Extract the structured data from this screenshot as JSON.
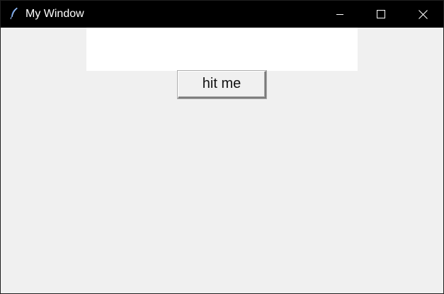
{
  "window": {
    "title": "My Window",
    "app_icon": "feather-icon",
    "controls": {
      "minimize_icon": "minimize-icon",
      "maximize_icon": "maximize-icon",
      "close_icon": "close-icon"
    }
  },
  "content": {
    "label_text": "",
    "button_label": "hit me"
  },
  "colors": {
    "titlebar": "#000000",
    "client_background": "#f0f0f0",
    "label_background": "#ffffff"
  }
}
